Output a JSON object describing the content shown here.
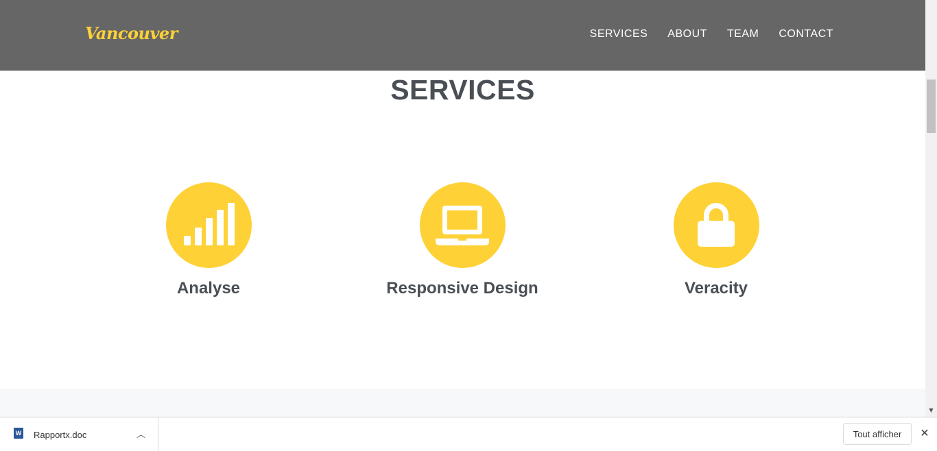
{
  "header": {
    "brand": "Vancouver",
    "nav": [
      "SERVICES",
      "ABOUT",
      "TEAM",
      "CONTACT"
    ]
  },
  "services": {
    "title": "SERVICES",
    "items": [
      {
        "label": "Analyse",
        "icon": "bar-chart-icon"
      },
      {
        "label": "Responsive Design",
        "icon": "laptop-icon"
      },
      {
        "label": "Veracity",
        "icon": "lock-icon"
      }
    ]
  },
  "download_bar": {
    "file_name": "Rapportx.doc",
    "show_all": "Tout afficher"
  },
  "colors": {
    "accent": "#fed136",
    "header_bg": "#666666",
    "heading": "#4a4f55"
  }
}
